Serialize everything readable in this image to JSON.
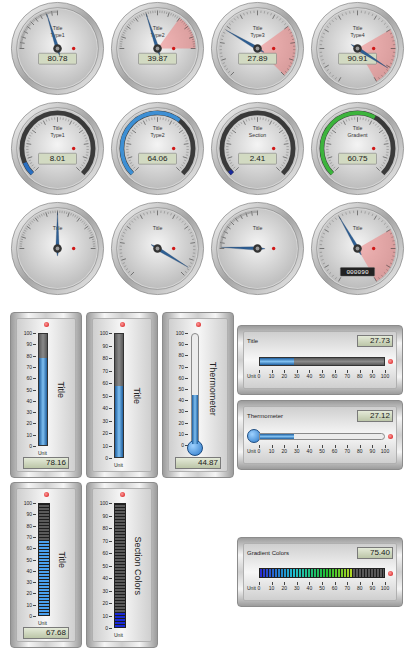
{
  "scale_ticks": [
    "0",
    "10",
    "20",
    "30",
    "40",
    "50",
    "60",
    "70",
    "80",
    "90",
    "100"
  ],
  "round_gauges": [
    {
      "title": "Title",
      "subtitle": "Type1",
      "kind": "type1",
      "level": 0.8078,
      "reading": "80.78"
    },
    {
      "title": "Title",
      "subtitle": "Type2",
      "kind": "type2",
      "level": 0.3987,
      "reading": "39.87",
      "area_from": 0.7
    },
    {
      "title": "Title",
      "subtitle": "Type3",
      "kind": "type3",
      "level": 0.2789,
      "reading": "27.89",
      "area_from": 0.7
    },
    {
      "title": "Title",
      "subtitle": "Type4",
      "kind": "type4",
      "level": 0.9091,
      "reading": "90.91",
      "area_from": 0.7
    },
    {
      "title": "Title",
      "subtitle": "Type1",
      "kind": "bar",
      "level": 0.0801,
      "reading": "8.01",
      "color": "#2a6fc0"
    },
    {
      "title": "Title",
      "subtitle": "Type2",
      "kind": "bar",
      "level": 0.6406,
      "reading": "64.06",
      "color": "#3d8fd4"
    },
    {
      "title": "Title",
      "subtitle": "Section",
      "kind": "bar",
      "level": 0.0241,
      "reading": "2.41",
      "color": "#1a2a9a"
    },
    {
      "title": "Title",
      "subtitle": "Gradient",
      "kind": "bar",
      "level": 0.6075,
      "reading": "60.75",
      "color": "#3cb43c"
    },
    {
      "title": "Title",
      "kind": "type2",
      "level": 0.5
    },
    {
      "title": "Title",
      "kind": "type3",
      "level": 0.95
    },
    {
      "title": "Title",
      "kind": "type1",
      "level": 0.02
    },
    {
      "title": "Title",
      "kind": "type4",
      "level": 0.4,
      "counter": "000090",
      "area_from": 0.7
    }
  ],
  "vertical_gauges": [
    {
      "title": "Title",
      "kind": "bar",
      "level": 0.7816,
      "reading": "78.16",
      "unit": "Unit"
    },
    {
      "title": "Title",
      "kind": "bar",
      "level": 0.58,
      "unit": "Unit"
    },
    {
      "title": "Thermometer",
      "kind": "thermometer",
      "level": 0.4487,
      "reading": "44.87"
    },
    {
      "title": "Title",
      "kind": "led",
      "level": 0.6768,
      "reading": "67.68",
      "unit": "Unit"
    },
    {
      "title": "Section Colors",
      "kind": "section",
      "level": 0.12,
      "unit": "Unit"
    }
  ],
  "horizontal_gauges": [
    {
      "title": "Title",
      "kind": "bar",
      "level": 0.2773,
      "reading": "27.73",
      "unit": "Unit"
    },
    {
      "title": "Thermometer",
      "kind": "thermometer",
      "level": 0.2712,
      "reading": "27.12",
      "unit": "Unit"
    },
    {
      "title": "Gradient Colors",
      "kind": "gradient",
      "level": 0.754,
      "reading": "75.40",
      "unit": "Unit"
    }
  ]
}
